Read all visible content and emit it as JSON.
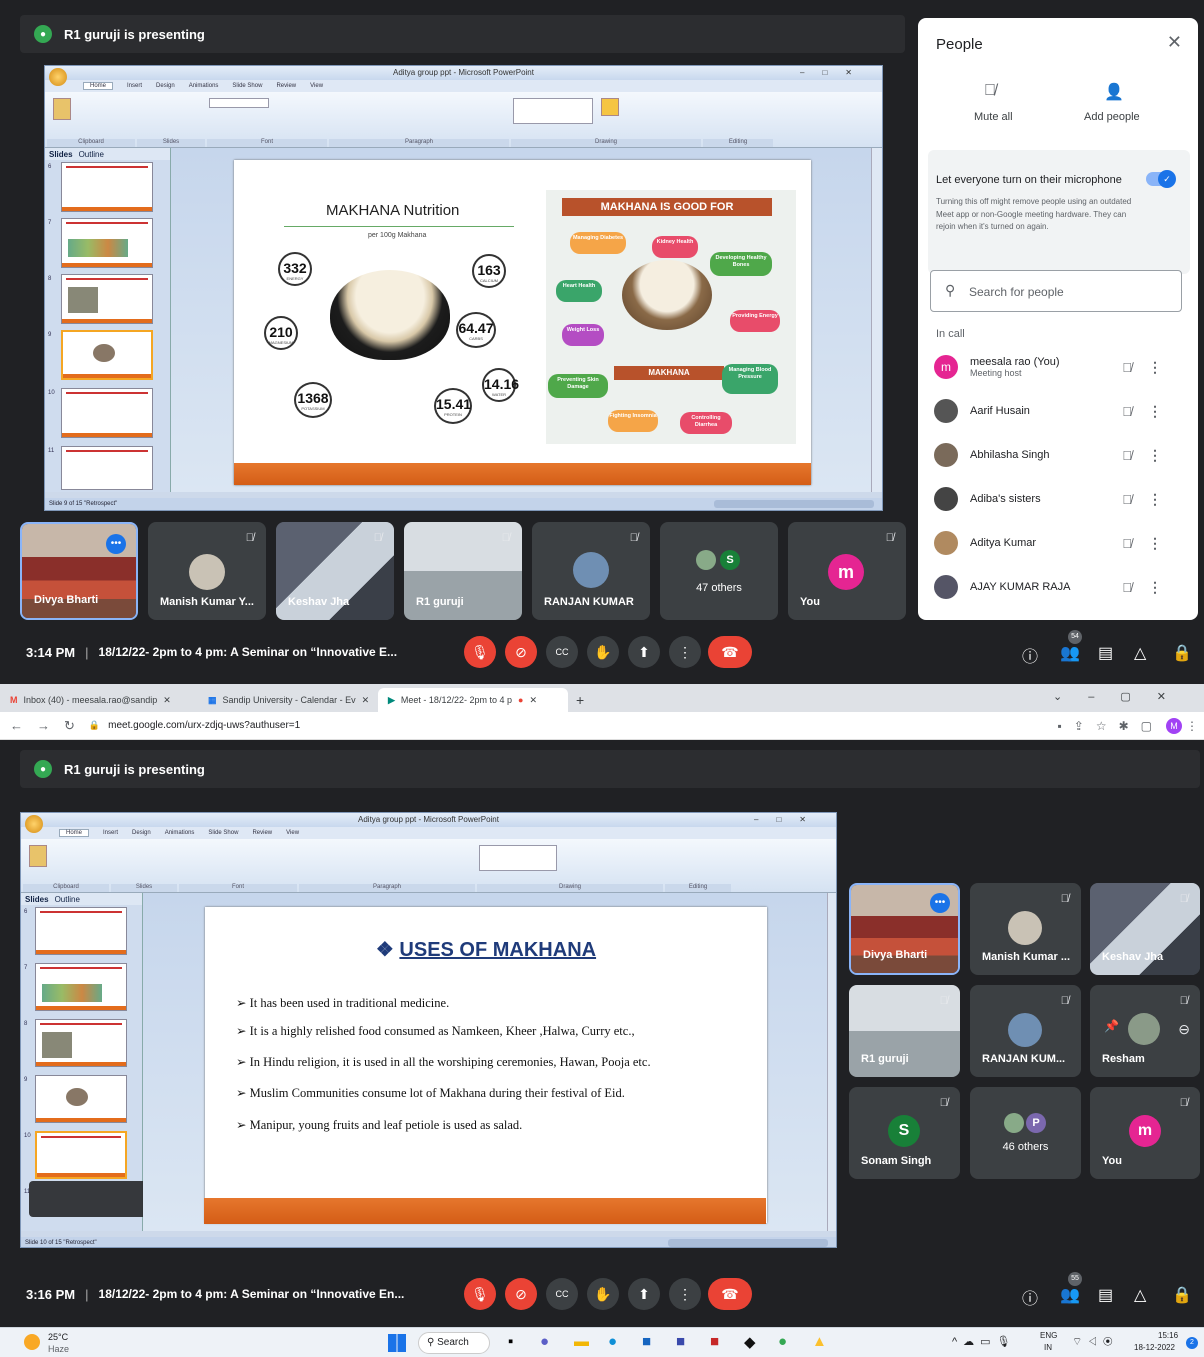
{
  "top": {
    "presenting_banner": "R1 guruji is presenting",
    "ppt_title": "Aditya group ppt - Microsoft PowerPoint",
    "ppt_tabs": [
      "Home",
      "Insert",
      "Design",
      "Animations",
      "Slide Show",
      "Review",
      "View"
    ],
    "ribbon_groups": [
      "Clipboard",
      "Slides",
      "Font",
      "Paragraph",
      "Drawing",
      "Editing"
    ],
    "panel_tabs": [
      "Slides",
      "Outline"
    ],
    "status_text": "Slide 9 of 15   \"Retrospect\"",
    "slide_numbers": [
      "6",
      "7",
      "8",
      "9",
      "10",
      "11"
    ],
    "slide": {
      "left_title": "MAKHANA Nutrition",
      "left_sub": "per 100g Makhana",
      "stats": [
        {
          "value": "332",
          "unit": "KCAL",
          "label": "ENERGY"
        },
        {
          "value": "163",
          "unit": "MG",
          "label": "CALCIUM"
        },
        {
          "value": "210",
          "unit": "MG",
          "label": "MAGNESIUM"
        },
        {
          "value": "64.47",
          "unit": "G",
          "label": "CARBS"
        },
        {
          "value": "1368",
          "unit": "MG",
          "label": "POTASSIUM"
        },
        {
          "value": "15.41",
          "unit": "G",
          "label": "PROTEIN"
        },
        {
          "value": "14.16",
          "unit": "G",
          "label": "WATER"
        }
      ],
      "right_title": "MAKHANA IS GOOD FOR",
      "center_label": "MAKHANA",
      "benefits": [
        "Managing Diabetes",
        "Kidney Health",
        "Developing Healthy Bones",
        "Heart Health",
        "Providing Energy",
        "Weight Loss",
        "Managing Blood Pressure",
        "Preventing Skin Damage",
        "Fighting Insomnia",
        "Controlling Diarrhea"
      ]
    },
    "tiles": [
      {
        "name": "Divya Bharti"
      },
      {
        "name": "Manish Kumar Y..."
      },
      {
        "name": "Keshav Jha"
      },
      {
        "name": "R1 guruji"
      },
      {
        "name": "RANJAN KUMAR"
      },
      {
        "name": "47 others",
        "avatar": "S"
      },
      {
        "name": "You",
        "avatar": "m"
      }
    ],
    "time": "3:14 PM",
    "meeting_title": "18/12/22- 2pm to 4 pm: A Seminar on “Innovative E...",
    "people_badge": "54"
  },
  "people": {
    "title": "People",
    "mute_all": "Mute all",
    "add_people": "Add people",
    "toggle_label": "Let everyone turn on their microphone",
    "toggle_desc": "Turning this off might remove people using an outdated Meet app or non-Google meeting hardware. They can rejoin when it's turned on again.",
    "search_placeholder": "Search for people",
    "in_call": "In call",
    "list": [
      {
        "name": "meesala rao (You)",
        "sub": "Meeting host",
        "initial": "m",
        "color": "#e52592"
      },
      {
        "name": "Aarif Husain",
        "sub": "",
        "initial": "",
        "color": "#555"
      },
      {
        "name": "Abhilasha Singh",
        "sub": "",
        "initial": "",
        "color": "#7a6a5a"
      },
      {
        "name": "Adiba's sisters",
        "sub": "",
        "initial": "",
        "color": "#444"
      },
      {
        "name": "Aditya Kumar",
        "sub": "",
        "initial": "",
        "color": "#b08a60"
      },
      {
        "name": "AJAY KUMAR RAJA",
        "sub": "",
        "initial": "",
        "color": "#556"
      }
    ]
  },
  "browser": {
    "tabs": [
      {
        "label": "Inbox (40) - meesala.rao@sandip"
      },
      {
        "label": "Sandip University - Calendar - Ev"
      },
      {
        "label": "Meet - 18/12/22- 2pm to 4 p"
      }
    ],
    "url": "meet.google.com/urx-zdjq-uws?authuser=1",
    "profile": "M"
  },
  "bottom": {
    "presenting_banner": "R1 guruji is presenting",
    "ppt_title": "Aditya group ppt - Microsoft PowerPoint",
    "status_text": "Slide 10 of 15   \"Retrospect\"",
    "slide_numbers": [
      "6",
      "7",
      "8",
      "9",
      "10",
      "11"
    ],
    "slide": {
      "title": "USES OF MAKHANA",
      "bullets": [
        "It has been used in traditional medicine.",
        "It is a highly relished food consumed as Namkeen, Kheer ,Halwa, Curry etc.,",
        "In Hindu religion, it is used in all the worshiping ceremonies, Hawan, Pooja etc.",
        "Muslim Communities consume lot of Makhana during their festival of Eid.",
        "Manipur, young fruits and leaf petiole is used as salad."
      ]
    },
    "tiles": [
      {
        "name": "Divya Bharti"
      },
      {
        "name": "Manish Kumar ..."
      },
      {
        "name": "Keshav Jha"
      },
      {
        "name": "R1 guruji"
      },
      {
        "name": "RANJAN KUM..."
      },
      {
        "name": "Resham"
      },
      {
        "name": "Sonam Singh",
        "avatar": "S"
      },
      {
        "name": "46 others",
        "avatar": "P"
      },
      {
        "name": "You",
        "avatar": "m"
      }
    ],
    "time": "3:16 PM",
    "meeting_title": "18/12/22- 2pm to 4 pm: A Seminar on “Innovative En...",
    "people_badge": "55"
  },
  "taskbar": {
    "temp": "25°C",
    "weather": "Haze",
    "search": "Search",
    "lang": "ENG",
    "region": "IN",
    "clock_time": "15:16",
    "clock_date": "18-12-2022",
    "notif": "2"
  }
}
